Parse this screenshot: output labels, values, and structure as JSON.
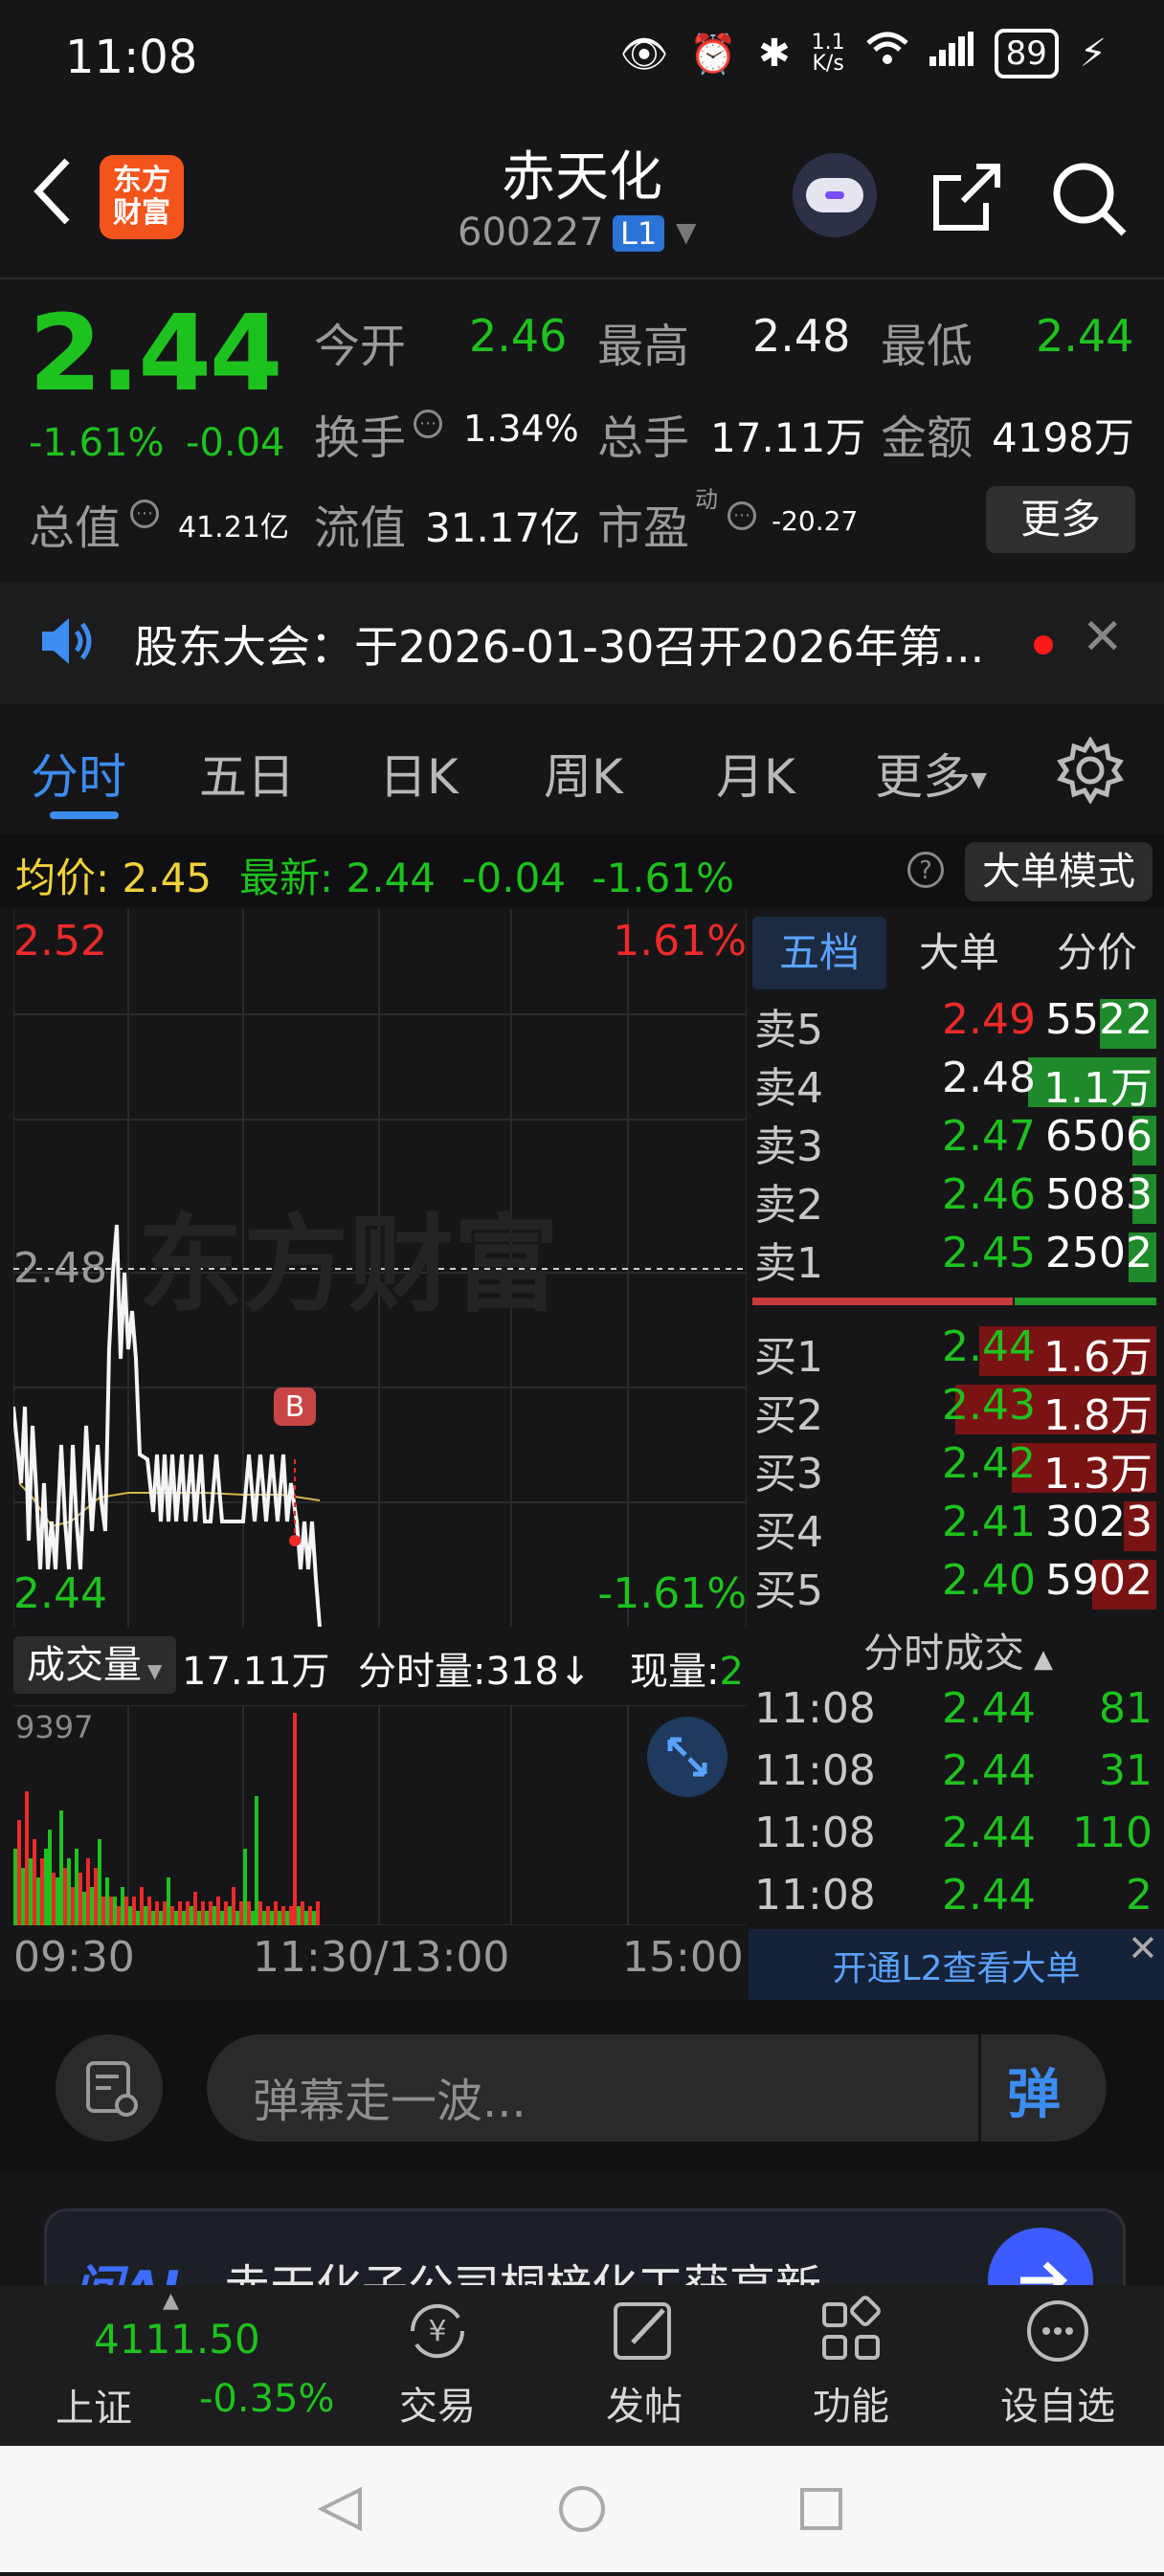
{
  "status_bar": {
    "time": "11:08",
    "net_speed_top": "1.1",
    "net_speed_bottom": "K/s",
    "battery": "89"
  },
  "header": {
    "logo_line1": "东方",
    "logo_line2": "财富",
    "stock_name": "赤天化",
    "stock_code": "600227",
    "level_badge": "L1"
  },
  "quote": {
    "price": "2.44",
    "change_pct": "-1.61%",
    "change_abs": "-0.04",
    "open_label": "今开",
    "open_value": "2.46",
    "high_label": "最高",
    "high_value": "2.48",
    "low_label": "最低",
    "low_value": "2.44",
    "turnover_label": "换手",
    "turnover_value": "1.34%",
    "volume_label": "总手",
    "volume_value": "17.11万",
    "amount_label": "金额",
    "amount_value": "4198万",
    "mktcap_label": "总值",
    "mktcap_value": "41.21亿",
    "float_label": "流值",
    "float_value": "31.17亿",
    "pe_label": "市盈",
    "pe_sup": "动",
    "pe_value": "-20.27",
    "more_button": "更多"
  },
  "notice": {
    "text": "股东大会：于2026-01-30召开2026年第..."
  },
  "tabs": [
    "分时",
    "五日",
    "日K",
    "周K",
    "月K",
    "更多"
  ],
  "info_line": {
    "avg_label": "均价:",
    "avg_value": "2.45",
    "latest_label": "最新:",
    "latest_value": "2.44",
    "latest_change": "-0.04",
    "latest_pct": "-1.61%",
    "help": "?",
    "big_order_mode": "大单模式"
  },
  "chart_labels": {
    "top_left": "2.52",
    "top_right": "1.61%",
    "ref_price": "2.48",
    "bottom_left": "2.44",
    "bottom_right": "-1.61%",
    "watermark": "东方财富",
    "buy_marker": "B"
  },
  "volume_bar": {
    "button": "成交量",
    "total": "17.11万",
    "minute_label": "分时量:318↓",
    "now_label": "现量:",
    "now_value": "2",
    "max_label": "9397"
  },
  "time_axis": [
    "09:30",
    "11:30/13:00",
    "15:00"
  ],
  "order_book": {
    "tabs": [
      "五档",
      "大单",
      "分价"
    ],
    "asks": [
      {
        "label": "卖5",
        "price": "2.49",
        "qty": "5522",
        "color": "#ee2a2a",
        "fill": 0.14
      },
      {
        "label": "卖4",
        "price": "2.48",
        "qty": "1.1万",
        "color": "#f2f2f2",
        "fill": 0.32
      },
      {
        "label": "卖3",
        "price": "2.47",
        "qty": "6506",
        "color": "#1ec21e",
        "fill": 0.06
      },
      {
        "label": "卖2",
        "price": "2.46",
        "qty": "5083",
        "color": "#1ec21e",
        "fill": 0.06
      },
      {
        "label": "卖1",
        "price": "2.45",
        "qty": "2502",
        "color": "#1ec21e",
        "fill": 0.07
      }
    ],
    "bids": [
      {
        "label": "买1",
        "price": "2.44",
        "qty": "1.6万",
        "color": "#1ec21e",
        "fill": 0.44
      },
      {
        "label": "买2",
        "price": "2.43",
        "qty": "1.8万",
        "color": "#1ec21e",
        "fill": 0.5
      },
      {
        "label": "买3",
        "price": "2.42",
        "qty": "1.3万",
        "color": "#1ec21e",
        "fill": 0.36
      },
      {
        "label": "买4",
        "price": "2.41",
        "qty": "3023",
        "color": "#1ec21e",
        "fill": 0.08
      },
      {
        "label": "买5",
        "price": "2.40",
        "qty": "5902",
        "color": "#1ec21e",
        "fill": 0.16
      }
    ],
    "ticks_title": "分时成交",
    "ticks": [
      {
        "time": "11:08",
        "price": "2.44",
        "vol": "81"
      },
      {
        "time": "11:08",
        "price": "2.44",
        "vol": "31"
      },
      {
        "time": "11:08",
        "price": "2.44",
        "vol": "110"
      },
      {
        "time": "11:08",
        "price": "2.44",
        "vol": "2"
      }
    ],
    "l2_banner": "开通L2查看大单"
  },
  "comment": {
    "placeholder": "弹幕走一波...",
    "danmu_button": "弹"
  },
  "ai_card": {
    "logo": "问AI",
    "text": "赤天化子公司桐梓化工获高新"
  },
  "bottom_nav": {
    "index_value": "4111.50",
    "index_name": "上证",
    "index_change": "-0.35%",
    "items": [
      "交易",
      "发帖",
      "功能",
      "设自选"
    ]
  },
  "colors": {
    "up": "#ee2a2a",
    "down": "#1ec21e",
    "accent": "#3d8cf0",
    "background": "#161618"
  }
}
